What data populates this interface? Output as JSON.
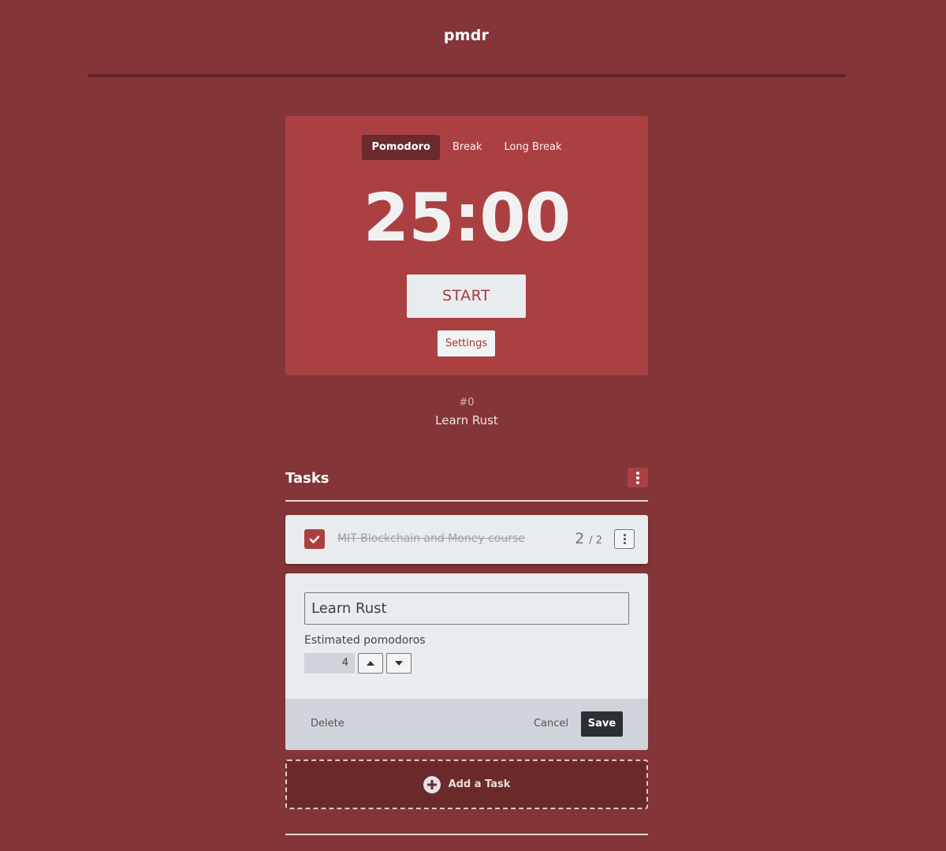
{
  "app": {
    "title": "pmdr"
  },
  "timer": {
    "modes": [
      {
        "label": "Pomodoro",
        "active": true
      },
      {
        "label": "Break",
        "active": false
      },
      {
        "label": "Long Break",
        "active": false
      }
    ],
    "time": "25:00",
    "start_label": "START",
    "settings_label": "Settings"
  },
  "current": {
    "number": "#0",
    "task": "Learn Rust"
  },
  "tasks": {
    "title": "Tasks",
    "menu_icon": "vertical-dots-icon",
    "items": [
      {
        "text": "MIT Blockchain and Money course",
        "done": true,
        "done_count": "2",
        "est_count": "/ 2"
      }
    ],
    "editor": {
      "title_value": "Learn Rust",
      "est_label": "Estimated pomodoros",
      "est_value": "4",
      "delete_label": "Delete",
      "cancel_label": "Cancel",
      "save_label": "Save"
    },
    "add_label": "Add a Task"
  },
  "colors": {
    "background": "#843537",
    "card": "#ab4042",
    "accent_dark": "#6b2a2c"
  }
}
